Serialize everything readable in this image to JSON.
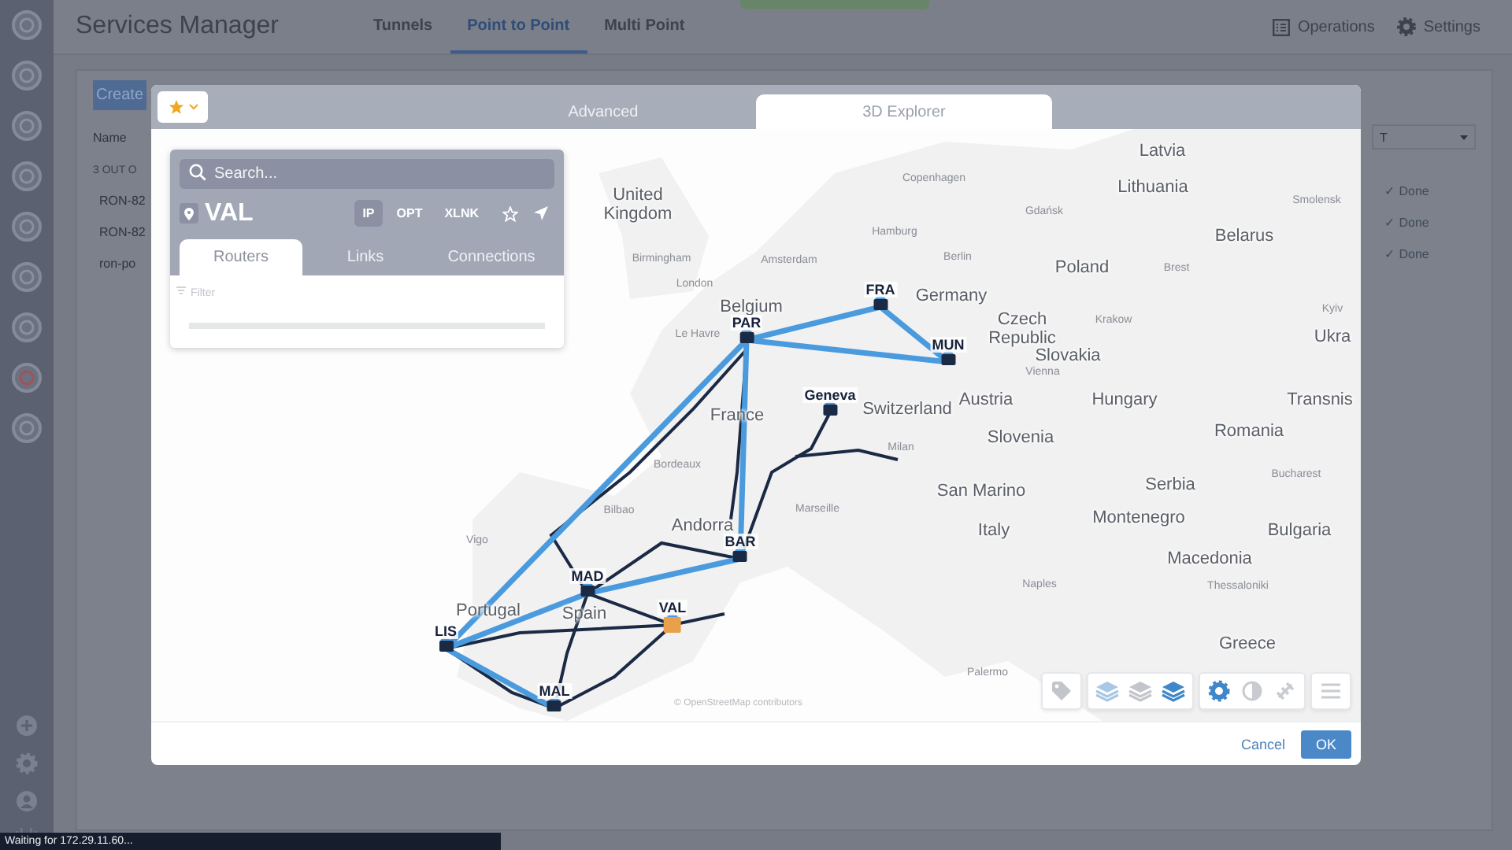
{
  "app": {
    "title": "Services Manager",
    "tabs": [
      {
        "label": "Tunnels",
        "selected": false
      },
      {
        "label": "Point to Point",
        "selected": true
      },
      {
        "label": "Multi Point",
        "selected": false
      }
    ],
    "actions": [
      "Operations",
      "Settings"
    ]
  },
  "services": {
    "create_button": "Create",
    "column_1": "Name",
    "summary": "3 OUT O",
    "rows": [
      "RON-82",
      "RON-82",
      "ron-po"
    ],
    "filter_field": "T",
    "statuses": [
      "✓ Done",
      "✓ Done",
      "✓ Done"
    ]
  },
  "status_bar": "Waiting for 172.29.11.60...",
  "dialog": {
    "tabs": [
      {
        "label": "Advanced",
        "selected": false
      },
      {
        "label": "3D Explorer",
        "selected": true
      }
    ],
    "panel": {
      "search": {
        "placeholder": "Search..."
      },
      "site": "VAL",
      "layers": [
        {
          "label": "IP",
          "selected": true
        },
        {
          "label": "OPT",
          "selected": false
        },
        {
          "label": "XLNK",
          "selected": false
        }
      ],
      "favorite": false,
      "tabs": [
        {
          "label": "Routers",
          "selected": true
        },
        {
          "label": "Links",
          "selected": false
        },
        {
          "label": "Connections",
          "selected": false
        }
      ],
      "filter": {
        "placeholder": "Filter"
      }
    },
    "map": {
      "labels": [
        {
          "text": "United Kingdom",
          "kind": "country"
        },
        {
          "text": "Latvia",
          "kind": "country"
        },
        {
          "text": "Lithuania",
          "kind": "country"
        },
        {
          "text": "Belarus",
          "kind": "country"
        },
        {
          "text": "Poland",
          "kind": "country"
        },
        {
          "text": "Belgium",
          "kind": "country"
        },
        {
          "text": "Germany",
          "kind": "country"
        },
        {
          "text": "Czech Republic",
          "kind": "country"
        },
        {
          "text": "Slovakia",
          "kind": "country"
        },
        {
          "text": "Ukra",
          "kind": "country"
        },
        {
          "text": "Austria",
          "kind": "country"
        },
        {
          "text": "Hungary",
          "kind": "country"
        },
        {
          "text": "Transnis",
          "kind": "country"
        },
        {
          "text": "France",
          "kind": "country"
        },
        {
          "text": "Switzerland",
          "kind": "country"
        },
        {
          "text": "Slovenia",
          "kind": "country"
        },
        {
          "text": "Romania",
          "kind": "country"
        },
        {
          "text": "Serbia",
          "kind": "country"
        },
        {
          "text": "San Marino",
          "kind": "country"
        },
        {
          "text": "Montenegro",
          "kind": "country"
        },
        {
          "text": "Italy",
          "kind": "country"
        },
        {
          "text": "Bulgaria",
          "kind": "country"
        },
        {
          "text": "Macedonia",
          "kind": "country"
        },
        {
          "text": "Andorra",
          "kind": "country"
        },
        {
          "text": "Portugal",
          "kind": "country"
        },
        {
          "text": "Spain",
          "kind": "country"
        },
        {
          "text": "Greece",
          "kind": "country"
        },
        {
          "text": "Copenhagen",
          "kind": "city"
        },
        {
          "text": "Gdańsk",
          "kind": "city"
        },
        {
          "text": "Smolensk",
          "kind": "city"
        },
        {
          "text": "Hamburg",
          "kind": "city"
        },
        {
          "text": "Amsterdam",
          "kind": "city"
        },
        {
          "text": "Berlin",
          "kind": "city"
        },
        {
          "text": "Brest",
          "kind": "city"
        },
        {
          "text": "Birmingham",
          "kind": "city"
        },
        {
          "text": "London",
          "kind": "city"
        },
        {
          "text": "Kyiv",
          "kind": "city"
        },
        {
          "text": "Le Havre",
          "kind": "city"
        },
        {
          "text": "Krakow",
          "kind": "city"
        },
        {
          "text": "Vienna",
          "kind": "city"
        },
        {
          "text": "Milan",
          "kind": "city"
        },
        {
          "text": "Bordeaux",
          "kind": "city"
        },
        {
          "text": "Bucharest",
          "kind": "city"
        },
        {
          "text": "Bilbao",
          "kind": "city"
        },
        {
          "text": "Marseille",
          "kind": "city"
        },
        {
          "text": "Vigo",
          "kind": "city"
        },
        {
          "text": "Naples",
          "kind": "city"
        },
        {
          "text": "Thessaloniki",
          "kind": "city"
        },
        {
          "text": "Palermo",
          "kind": "city"
        }
      ],
      "nodes": [
        {
          "label": "PAR",
          "selected": false
        },
        {
          "label": "FRA",
          "selected": false
        },
        {
          "label": "MUN",
          "selected": false
        },
        {
          "label": "Geneva",
          "selected": false
        },
        {
          "label": "BAR",
          "selected": false
        },
        {
          "label": "MAD",
          "selected": false
        },
        {
          "label": "VAL",
          "selected": true
        },
        {
          "label": "LIS",
          "selected": false
        },
        {
          "label": "MAL",
          "selected": false
        }
      ],
      "attribution": "© OpenStreetMap contributors",
      "layer_buttons": [
        {
          "selected": false
        },
        {
          "selected": false
        },
        {
          "selected": true
        }
      ],
      "view_buttons": [
        {
          "selected": true
        },
        {
          "selected": false
        },
        {
          "selected": false
        }
      ]
    },
    "buttons": {
      "cancel": "Cancel",
      "ok": "OK"
    }
  }
}
